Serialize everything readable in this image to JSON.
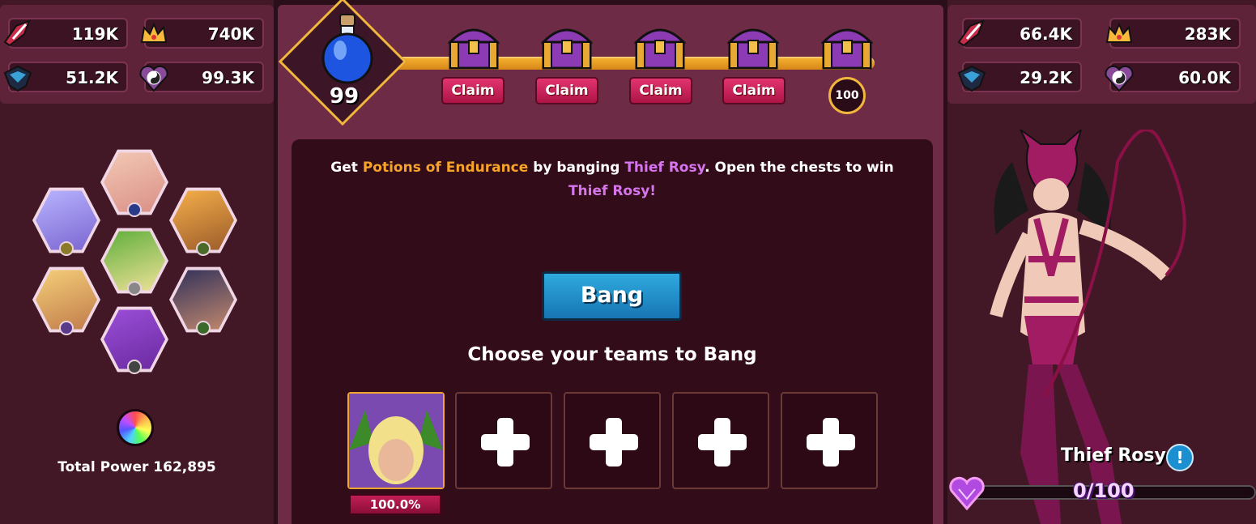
{
  "left_stats": {
    "hardcore": "119K",
    "charm": "740K",
    "know_how": "51.2K",
    "ego": "99.3K"
  },
  "right_stats": {
    "hardcore": "66.4K",
    "charm": "283K",
    "know_how": "29.2K",
    "ego": "60.0K"
  },
  "team": {
    "total_power_label": "Total Power 162,895"
  },
  "rewards": {
    "potion_count": "99",
    "claim_labels": [
      "Claim",
      "Claim",
      "Claim",
      "Claim"
    ],
    "last_threshold": "100",
    "progress_fraction": 0.99
  },
  "description": {
    "prefix": "Get ",
    "item": "Potions of Endurance",
    "middle": " by banging ",
    "target": "Thief Rosy",
    "suffix": ". Open the chests to win",
    "target2": "Thief Rosy!"
  },
  "bang_label": "Bang",
  "choose_label": "Choose your teams to Bang",
  "team_slots": {
    "first_percent": "100.0%"
  },
  "opponent": {
    "name": "Thief Rosy",
    "info_icon": "!",
    "affection": "0/100",
    "affection_fraction": 0
  },
  "colors": {
    "accent_orange": "#f7a42a",
    "accent_pink": "#d675ee",
    "claim_red": "#e33470",
    "bang_blue": "#2fa9df"
  }
}
